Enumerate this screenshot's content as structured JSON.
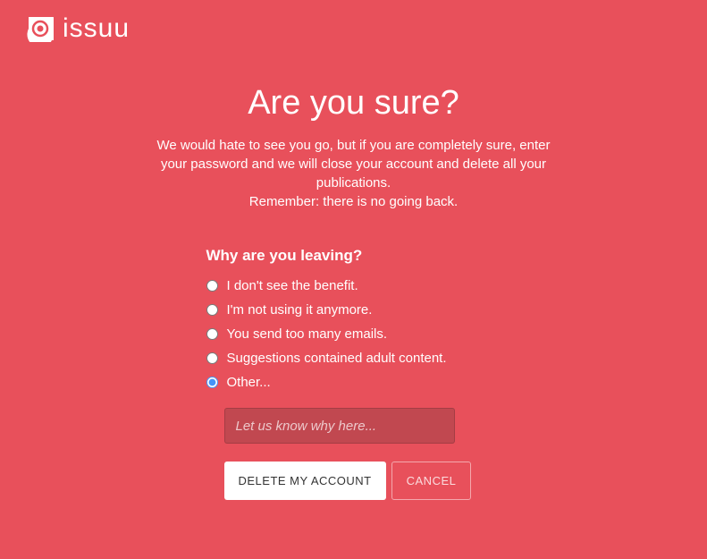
{
  "brand": "issuu",
  "title": "Are you sure?",
  "description_line1": "We would hate to see you go, but if you are completely sure, enter your password and we will close your account and delete all your publications.",
  "description_line2": "Remember: there is no going back.",
  "question": "Why are you leaving?",
  "options": {
    "benefit": "I don't see the benefit.",
    "not_using": "I'm not using it anymore.",
    "emails": "You send too many emails.",
    "adult": "Suggestions contained adult content.",
    "other": "Other..."
  },
  "selected": "other",
  "reason_placeholder": "Let us know why here...",
  "buttons": {
    "delete": "DELETE MY ACCOUNT",
    "cancel": "CANCEL"
  }
}
